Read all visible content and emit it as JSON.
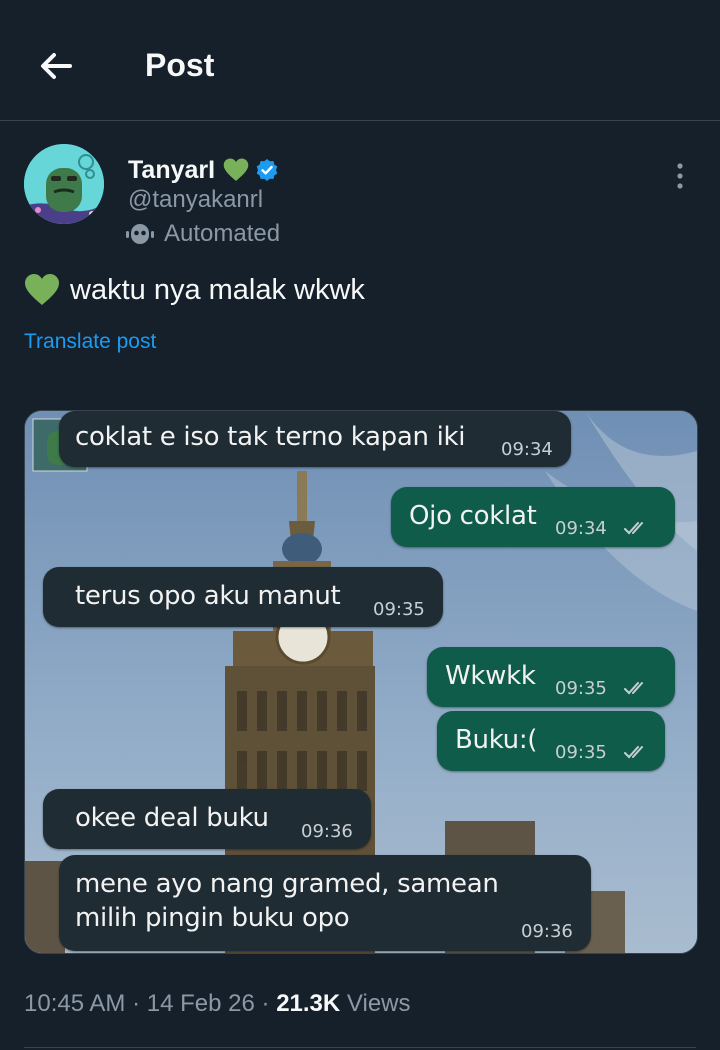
{
  "header": {
    "title": "Post"
  },
  "author": {
    "name": "TanyarI",
    "handle": "@tanyakanrl",
    "automated_label": "Automated"
  },
  "post": {
    "text": "waktu nya malak wkwk",
    "translate_label": "Translate post"
  },
  "chat": {
    "messages": [
      {
        "direction": "incoming",
        "text": "coklat e iso tak terno kapan iki",
        "time": "09:34"
      },
      {
        "direction": "outgoing",
        "text": "Ojo coklat",
        "time": "09:34",
        "status": "read"
      },
      {
        "direction": "incoming",
        "text": "terus opo aku manut",
        "time": "09:35"
      },
      {
        "direction": "outgoing",
        "text": "Wkwkk",
        "time": "09:35",
        "status": "read"
      },
      {
        "direction": "outgoing",
        "text": "Buku:(",
        "time": "09:35",
        "status": "read"
      },
      {
        "direction": "incoming",
        "text": "okee deal buku",
        "time": "09:36"
      },
      {
        "direction": "incoming",
        "text_line1": "mene ayo nang gramed, samean",
        "text_line2": "milih pingin buku opo",
        "time": "09:36"
      }
    ]
  },
  "meta": {
    "time": "10:45 AM",
    "date": "14 Feb 26",
    "separator": "·",
    "views_count": "21.3K",
    "views_label": "Views"
  },
  "colors": {
    "background": "#15202b",
    "accent": "#1d9bf0",
    "verified": "#1d9bf0",
    "heart": "#78b159",
    "outgoing_bubble": "#0f5c4a",
    "incoming_bubble": "#1f2c34"
  },
  "icons": [
    "back-arrow-icon",
    "green-heart-icon",
    "verified-badge-icon",
    "bot-icon",
    "more-vertical-icon",
    "double-check-icon"
  ]
}
